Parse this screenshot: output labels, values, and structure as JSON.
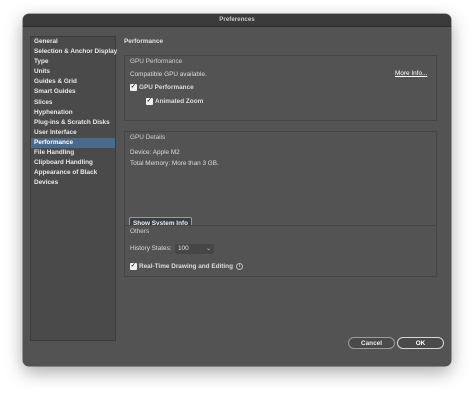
{
  "window": {
    "title": "Preferences"
  },
  "sidebar": {
    "items": [
      {
        "label": "General"
      },
      {
        "label": "Selection & Anchor Display"
      },
      {
        "label": "Type"
      },
      {
        "label": "Units"
      },
      {
        "label": "Guides & Grid"
      },
      {
        "label": "Smart Guides"
      },
      {
        "label": "Slices"
      },
      {
        "label": "Hyphenation"
      },
      {
        "label": "Plug-ins & Scratch Disks"
      },
      {
        "label": "User Interface"
      },
      {
        "label": "Performance",
        "selected": true
      },
      {
        "label": "File Handling"
      },
      {
        "label": "Clipboard Handling"
      },
      {
        "label": "Appearance of Black"
      },
      {
        "label": "Devices"
      }
    ]
  },
  "main": {
    "title": "Performance",
    "gpu_performance": {
      "title": "GPU Performance",
      "status": "Compatible GPU available.",
      "more_info": "More Info...",
      "gpu_checkbox": {
        "label": "GPU Performance",
        "checked": true
      },
      "zoom_checkbox": {
        "label": "Animated Zoom",
        "checked": true
      }
    },
    "gpu_details": {
      "title": "GPU Details",
      "device": "Device: Apple M2",
      "memory": "Total Memory:  More than 3 GB.",
      "system_info_button": "Show System Info"
    },
    "others": {
      "title": "Others",
      "history_label": "History States:",
      "history_value": "100",
      "realtime_checkbox": {
        "label": "Real-Time Drawing and Editing",
        "checked": true
      }
    }
  },
  "footer": {
    "cancel_label": "Cancel",
    "ok_label": "OK"
  },
  "colors": {
    "panel": "#535353",
    "selected": "#4a6a8c",
    "titlebar": "#3b3b3b"
  }
}
